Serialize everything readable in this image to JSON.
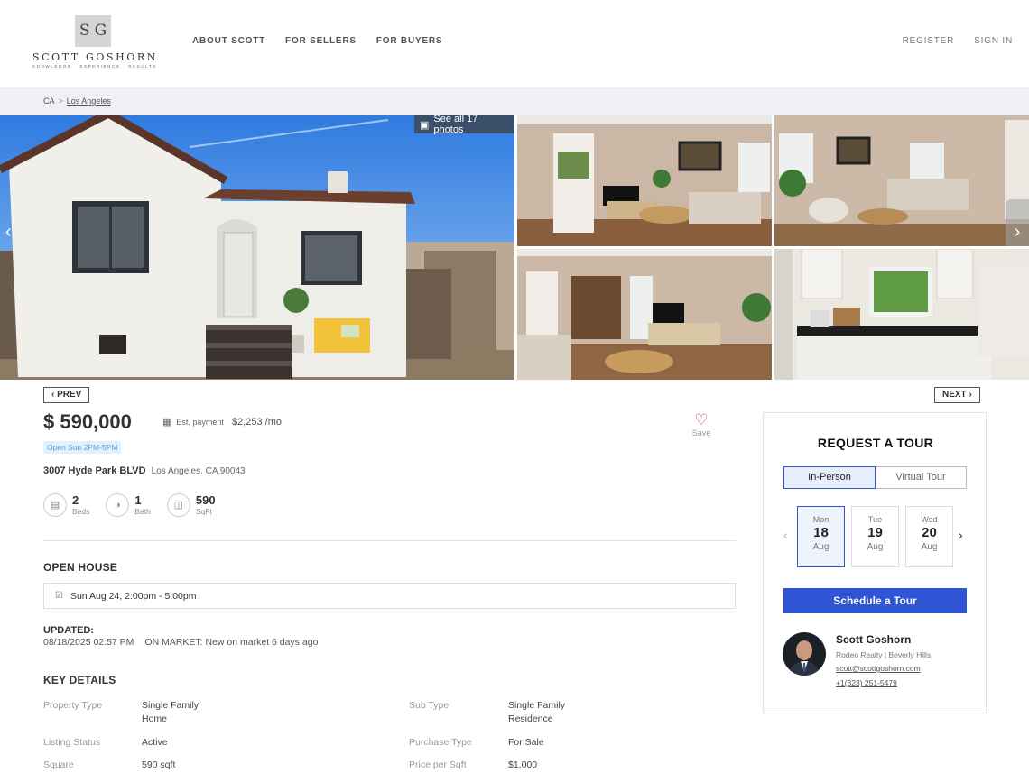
{
  "brand": {
    "initials": "SG",
    "name": "SCOTT GOSHORN",
    "tagline": "KNOWLEDGE · EXPERIENCE · RESULTS"
  },
  "nav": {
    "items": [
      "ABOUT SCOTT",
      "FOR SELLERS",
      "FOR BUYERS"
    ],
    "register": "REGISTER",
    "sign_in": "SIGN IN"
  },
  "breadcrumb": {
    "state": "CA",
    "separator": ">",
    "city": "Los Angeles"
  },
  "gallery": {
    "see_all": "See all 17 photos"
  },
  "pager": {
    "prev": "PREV",
    "next": "NEXT"
  },
  "listing": {
    "price": "$ 590,000",
    "est_payment_label": "Est. payment",
    "est_payment_value": "$2,253 /mo",
    "open_badge": "Open Sun 2PM-5PM",
    "save_label": "Save",
    "street": "3007 Hyde Park BLVD",
    "city_line": "Los Angeles, CA 90043",
    "beds": {
      "value": "2",
      "label": "Beds"
    },
    "baths": {
      "value": "1",
      "label": "Bath"
    },
    "sqft": {
      "value": "590",
      "label": "SqFt"
    }
  },
  "open_house": {
    "heading": "OPEN HOUSE",
    "entry": "Sun Aug 24, 2:00pm - 5:00pm"
  },
  "updated": {
    "heading": "UPDATED:",
    "timestamp": "08/18/2025 02:57 PM",
    "market": "ON MARKET: New on market 6 days ago"
  },
  "key_details": {
    "heading": "KEY DETAILS",
    "rows": [
      {
        "l1": "Property Type",
        "v1a": "Single Family",
        "v1b": "Home",
        "l2": "Sub Type",
        "v2a": "Single Family",
        "v2b": "Residence"
      },
      {
        "l1": "Listing Status",
        "v1a": "Active",
        "v1b": "",
        "l2": "Purchase Type",
        "v2a": "For Sale",
        "v2b": ""
      },
      {
        "l1": "Square",
        "v1a": "590 sqft",
        "v1b": "",
        "l2": "Price per Sqft",
        "v2a": "$1,000",
        "v2b": ""
      }
    ]
  },
  "tour": {
    "title": "REQUEST A TOUR",
    "tab_in_person": "In-Person",
    "tab_virtual": "Virtual Tour",
    "days": [
      {
        "dow": "Mon",
        "day": "18",
        "month": "Aug"
      },
      {
        "dow": "Tue",
        "day": "19",
        "month": "Aug"
      },
      {
        "dow": "Wed",
        "day": "20",
        "month": "Aug"
      }
    ],
    "schedule_button": "Schedule a Tour"
  },
  "agent": {
    "name": "Scott Goshorn",
    "company": "Rodeo Realty | Beverly Hills",
    "email": "scott@scottgoshorn.com",
    "phone": "+1(323) 251-5479"
  },
  "colors": {
    "accent": "#2f55d4",
    "heart": "#e04848",
    "badge_bg": "#e3f1fc",
    "badge_text": "#4aa3e0",
    "crumb_bg": "#eef0f5"
  }
}
